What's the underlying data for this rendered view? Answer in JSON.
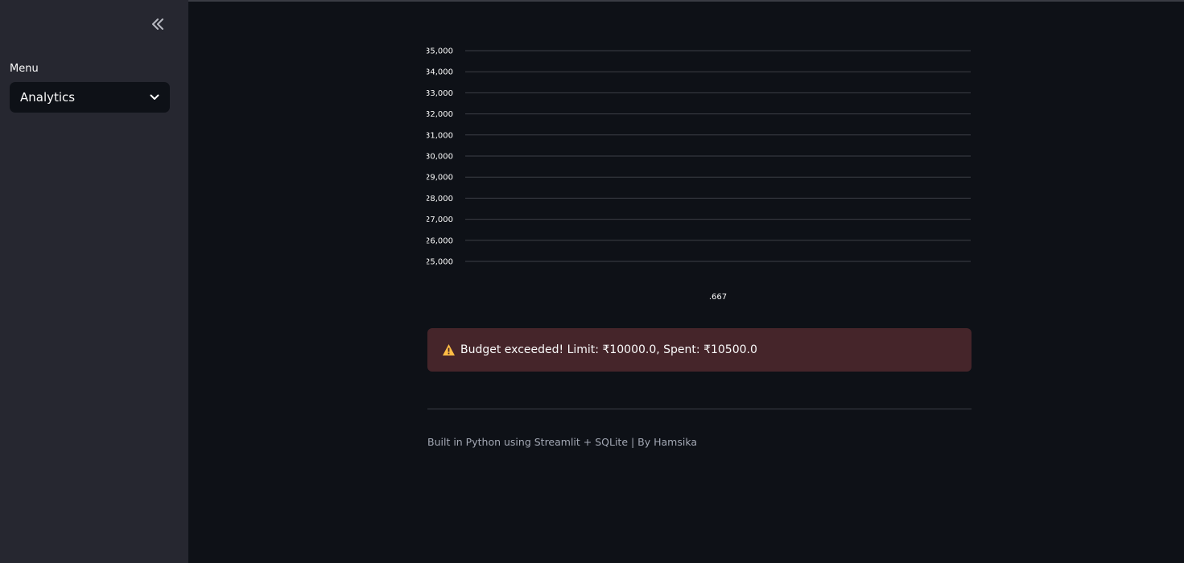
{
  "sidebar": {
    "collapse_icon": "double-chevron-left-icon",
    "menu_label": "Menu",
    "menu_selected": "Analytics"
  },
  "chart_data": {
    "type": "bar",
    "categories": [
      ".667"
    ],
    "values": [],
    "y_ticks": [
      "35,000",
      "34,000",
      "33,000",
      "32,000",
      "31,000",
      "30,000",
      "29,000",
      "28,000",
      "27,000",
      "26,000",
      "25,000"
    ],
    "ylim": [
      25000,
      35000
    ],
    "grid": true
  },
  "alert": {
    "icon": "warning-icon",
    "text": "Budget exceeded! Limit: ₹10000.0, Spent: ₹10500.0",
    "icon_color": "#ffbd45",
    "background": "#45252a"
  },
  "footer": {
    "text": "Built in Python using Streamlit + SQLite | By Hamsika"
  }
}
